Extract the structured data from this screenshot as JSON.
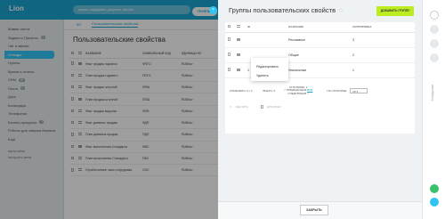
{
  "header": {
    "logo": "Lion",
    "search_placeholder": "искать сотрудника, документ, прочее...",
    "groups_pill": "ГРУППЫ"
  },
  "sidebar": {
    "items": [
      {
        "label": "Живая лента",
        "badge": ""
      },
      {
        "label": "Задачи и Проекты",
        "badge": "6"
      },
      {
        "label": "Чат и звонки",
        "badge": ""
      },
      {
        "label": "Стенды",
        "badge": "",
        "active": true
      },
      {
        "label": "Группы",
        "badge": ""
      },
      {
        "label": "Время и отчеты",
        "badge": ""
      },
      {
        "label": "CRM",
        "badge": "99"
      },
      {
        "label": "Почта",
        "badge": "4"
      },
      {
        "label": "Диск",
        "badge": ""
      },
      {
        "label": "Календарь",
        "badge": ""
      },
      {
        "label": "Телефония",
        "badge": ""
      },
      {
        "label": "Бизнес-процессы",
        "badge": "3"
      },
      {
        "label": "Роботы для запуска бизнеса",
        "badge": ""
      },
      {
        "label": "Ещё",
        "badge": ""
      }
    ],
    "footer_links": [
      "карта сайта",
      "настроить меню"
    ]
  },
  "background": {
    "tabs": [
      "КП",
      "Пользовательские свойства"
    ],
    "title": "Пользовательские свойства",
    "columns": [
      "",
      "",
      "НАЗВАНИЕ",
      "СИМВОЛЬНЫЙ КОД",
      "ЕДИНИЦЫ ИЗ"
    ],
    "rows": [
      [
        "Факт продаж годового",
        "ФПГО",
        "RUB/шт"
      ],
      [
        "План продаж годового",
        "ППГО",
        "RUB/шт"
      ],
      [
        "Факт продаж штучной",
        "ФПШ",
        "RUB/шт"
      ],
      [
        "План продаж штучной",
        "ППШ",
        "RUB/шт"
      ],
      [
        "Факт продаж выручки",
        "ФПВ",
        "RUB/шт"
      ],
      [
        "Факт дневных продаж",
        "ФДП",
        "RUB/шт"
      ],
      [
        "План дневных продаж",
        "ПДП",
        "RUB/шт"
      ],
      [
        "Факт выполнения Стандарта",
        "ФВС",
        "RUB/шт"
      ],
      [
        "План выполнения Стандарта",
        "ПВС",
        "RUB/шт"
      ],
      [
        "Отработанные часы сотрудника",
        "ОЧС",
        "RUB/шт"
      ]
    ]
  },
  "panel": {
    "title": "Группы пользовательских свойств",
    "add_button": "ДОБАВИТЬ ГРУППУ",
    "columns": [
      "",
      "",
      "ID",
      "НАЗВАНИЕ",
      "СОРТИРОВКА"
    ],
    "rows": [
      {
        "id": "",
        "name": "Рекламные",
        "sort": "3"
      },
      {
        "id": "",
        "name": "Общие",
        "sort": "2"
      },
      {
        "id": "1",
        "name": "Уникальные",
        "sort": "1"
      }
    ],
    "dropdown": [
      "Редактировать",
      "Удалить"
    ],
    "pager": {
      "selected": "ОТМЕЧЕНО: 0 / 3",
      "total": "ВСЕГО: 3",
      "pages_label": "СТРАНИЦЫ:",
      "pages_value": "1",
      "prev": "< ПРЕДЫДУЩАЯ",
      "all": "ВСЕ",
      "next": "СЛЕДУЮЩАЯ >",
      "per_page_label": "НА СТРАНИЦЕ:",
      "per_page_value": "20"
    },
    "delete_label": "УДАЛИТЬ",
    "for_all_label": "ДЛЯ ВСЕХ",
    "close_button": "ЗАКРЫТЬ"
  },
  "rail": {
    "vertical_label": "Сотрудники"
  },
  "colors": {
    "accent": "#2fc6f6",
    "topbar": "#1aa4cf",
    "add_button": "#bbed21"
  }
}
